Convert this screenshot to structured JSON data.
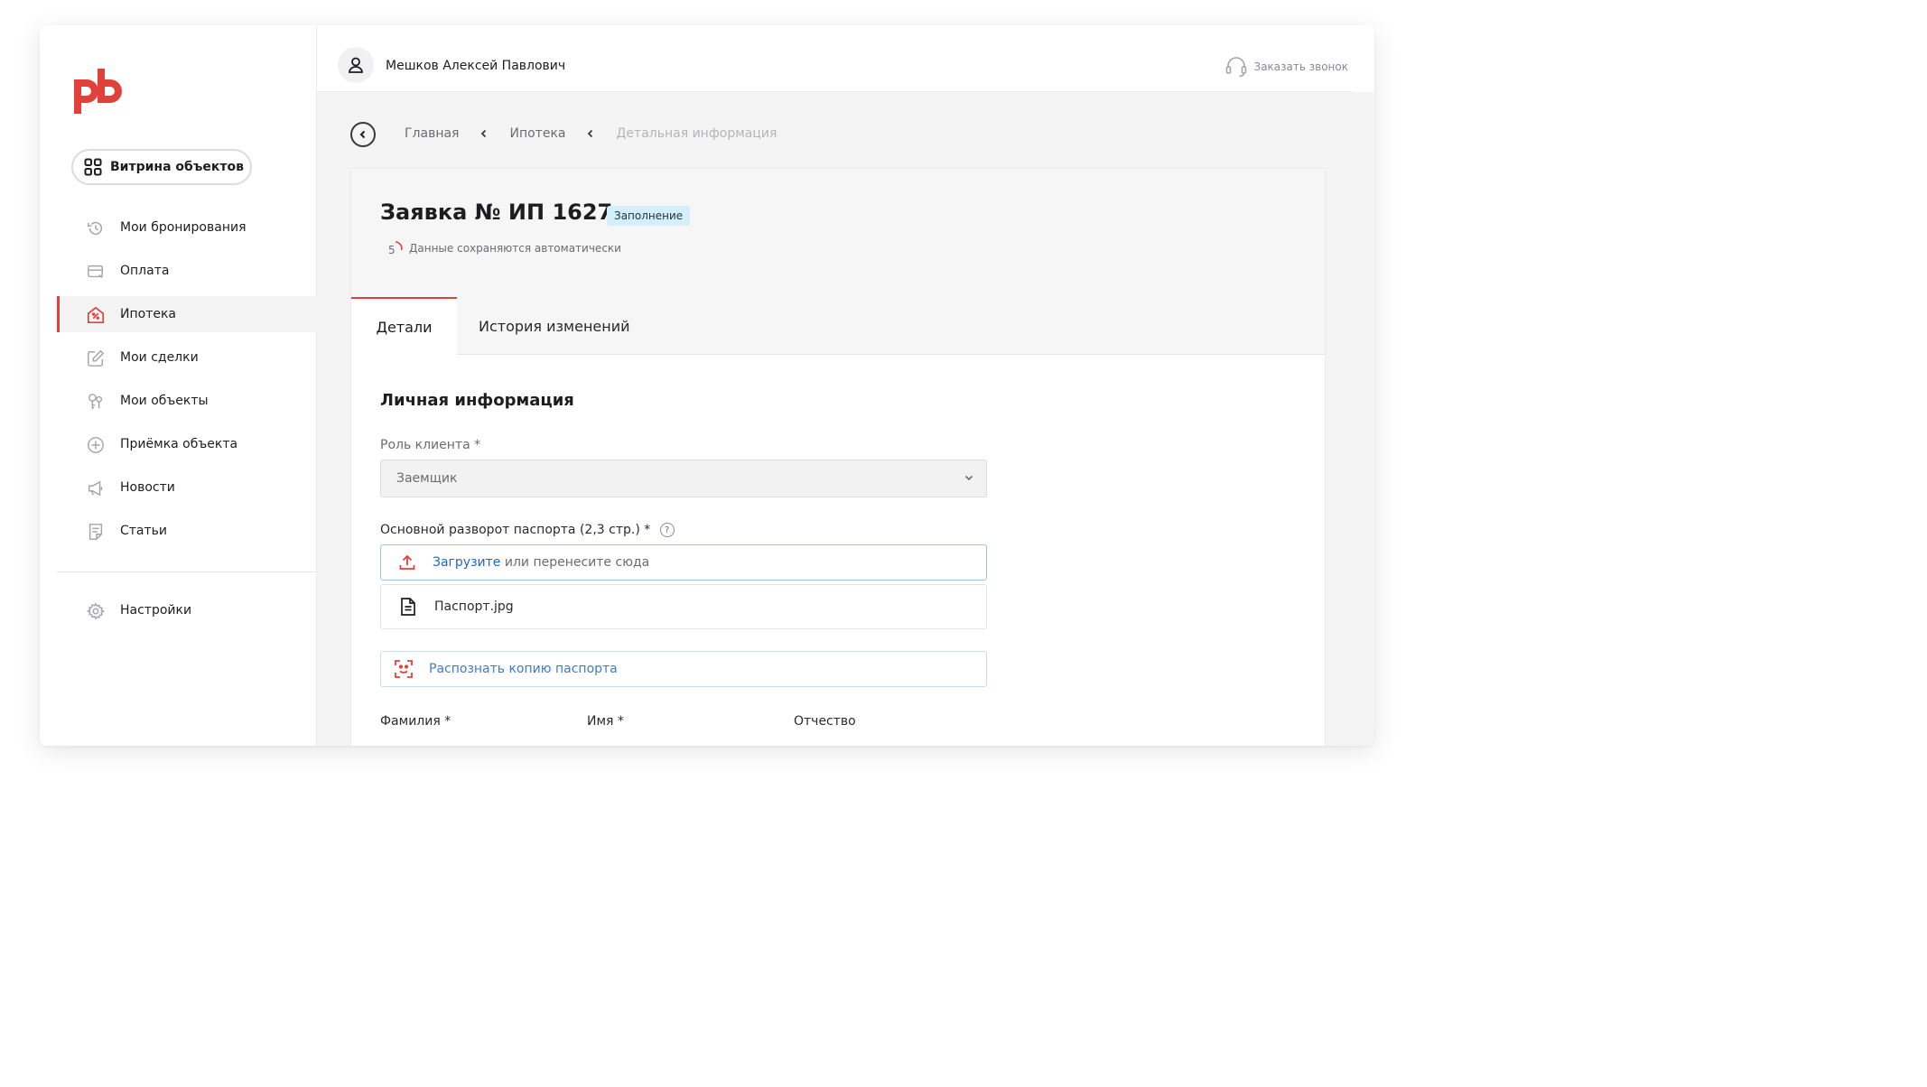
{
  "sidebar": {
    "logo_text": "pb",
    "showcase_label": "Витрина объектов",
    "items": [
      {
        "label": "Мои бронирования",
        "icon": "history-icon",
        "active": false
      },
      {
        "label": "Оплата",
        "icon": "card-icon",
        "active": false
      },
      {
        "label": "Ипотека",
        "icon": "mortgage-house-icon",
        "active": true
      },
      {
        "label": "Мои сделки",
        "icon": "edit-icon",
        "active": false
      },
      {
        "label": "Мои объекты",
        "icon": "keys-icon",
        "active": false
      },
      {
        "label": "Приёмка объекта",
        "icon": "plus-circle-icon",
        "active": false
      },
      {
        "label": "Новости",
        "icon": "megaphone-icon",
        "active": false
      },
      {
        "label": "Статьи",
        "icon": "document-icon",
        "active": false
      }
    ],
    "settings_label": "Настройки"
  },
  "header": {
    "user_name": "Мешков Алексей Павлович",
    "callback_label": "Заказать звонок"
  },
  "breadcrumb": {
    "items": [
      "Главная",
      "Ипотека",
      "Детальная информация"
    ]
  },
  "application": {
    "title": "Заявка № ИП 1627",
    "status": "Заполнение",
    "autosave_counter": "5",
    "autosave_text": "Данные сохраняются автоматически"
  },
  "tabs": [
    "Детали",
    "История изменений"
  ],
  "form": {
    "section_title": "Личная информация",
    "role_label": "Роль клиента *",
    "role_value": "Заемщик",
    "passport_label": "Основной разворот паспорта (2,3 стр.) *",
    "help_symbol": "?",
    "upload_link": "Загрузите",
    "upload_rest": " или перенесите сюда",
    "file_name": "Паспорт.jpg",
    "recognize_label": "Распознать копию паспорта",
    "surname_label": "Фамилия *",
    "firstname_label": "Имя *",
    "patronymic_label": "Отчество"
  },
  "colors": {
    "accent": "#e2403a",
    "link": "#1c6bc4",
    "badge_bg": "#d4eefa"
  }
}
